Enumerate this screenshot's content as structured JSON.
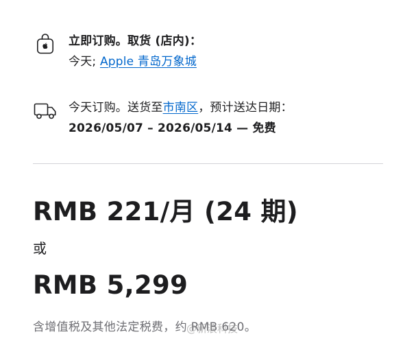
{
  "pickup": {
    "icon": "shopping-bag-apple-icon",
    "heading": "立即订购。取货 (店内)：",
    "day_prefix": "今天; ",
    "store_link": "Apple 青岛万象城"
  },
  "delivery": {
    "icon": "delivery-truck-icon",
    "text_prefix": "今天订购。送货至",
    "district_link": "市南区",
    "text_suffix": "，预计送达日期：",
    "date_range": "2026/05/07 – 2026/05/14 — 免费"
  },
  "price": {
    "monthly": "RMB 221/月 (24 期)",
    "or_label": "或",
    "full": "RMB 5,299",
    "tax_note": "含增值税及其他法定税费，约 RMB 620。"
  },
  "watermark": {
    "text": "@新浪科技"
  },
  "colors": {
    "text": "#1d1d1f",
    "link": "#0066cc",
    "secondary": "#6e6e73",
    "divider": "#d2d2d7"
  }
}
